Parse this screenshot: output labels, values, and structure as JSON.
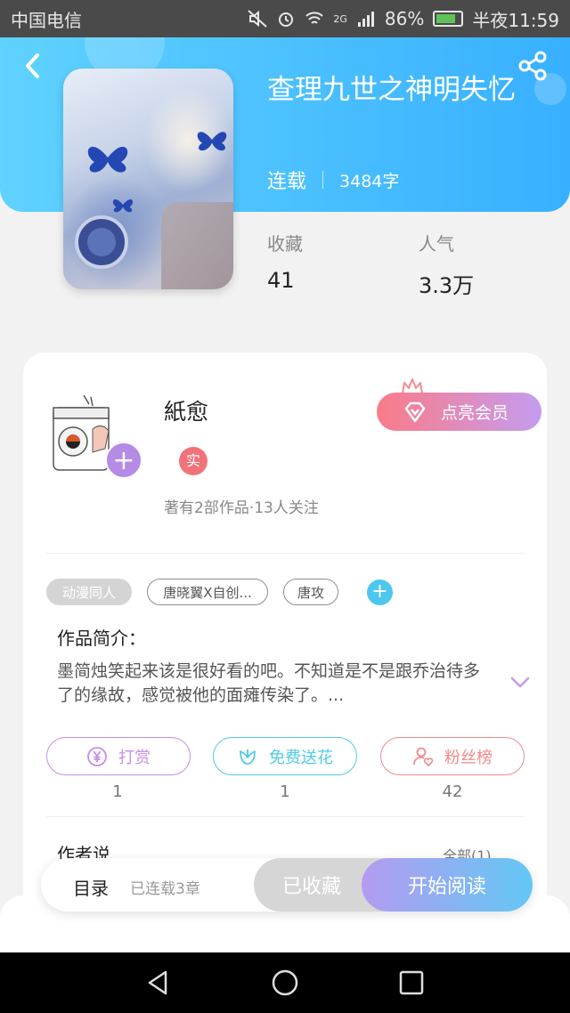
{
  "status_bar": {
    "carrier": "中国电信",
    "battery": "86%",
    "network": "2G",
    "time": "半夜11:59"
  },
  "book": {
    "title": "查理九世之神明失忆",
    "serial_status": "连载",
    "word_count": "3484字",
    "stats": [
      {
        "label": "收藏",
        "value": "41"
      },
      {
        "label": "人气",
        "value": "3.3万"
      }
    ]
  },
  "author": {
    "name": "紙愈",
    "badge": "实",
    "meta": "著有2部作品·13人关注",
    "vip_button": "点亮会员"
  },
  "tags": [
    "动漫同人",
    "唐晓翼X自创...",
    "唐攻"
  ],
  "intro": {
    "heading": "作品简介：",
    "text": "墨简烛笑起来该是很好看的吧。不知道是不是跟乔治待多了的缘故，感觉被他的面瘫传染了。..."
  },
  "actions": [
    {
      "label": "打赏",
      "count": "1",
      "color": "#c58ee8"
    },
    {
      "label": "免费送花",
      "count": "1",
      "color": "#4fcbe6"
    },
    {
      "label": "粉丝榜",
      "count": "42",
      "color": "#f28a8a"
    }
  ],
  "author_says": {
    "heading": "作者说",
    "link": "全部(1)"
  },
  "bottom_bar": {
    "toc": "目录",
    "chapters": "已连载3章",
    "collected": "已收藏",
    "read": "开始阅读"
  }
}
